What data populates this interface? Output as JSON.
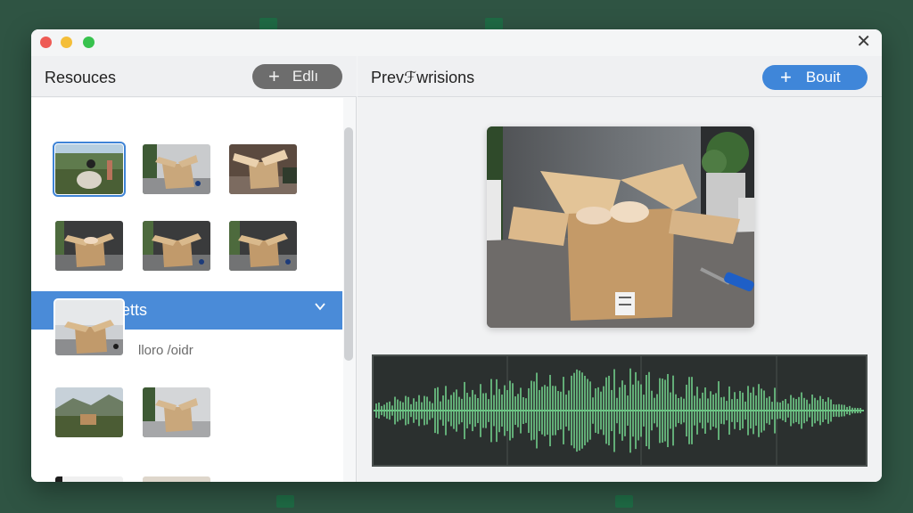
{
  "window": {
    "left_panel": {
      "title": "Resouces",
      "edit_button": {
        "icon": "plus-icon",
        "label": "Edlı"
      },
      "dropdown": {
        "label": "Seletts",
        "icon": "chevron-down-icon"
      },
      "hint": "lloro /oidr"
    },
    "right_panel": {
      "title": "Prevℱwrisions",
      "bout_button": {
        "icon": "plus-icon",
        "label": "Bouit"
      }
    }
  },
  "colors": {
    "accent": "#4a8bd8",
    "background": "#2f5443",
    "waveform": "#6cc384"
  }
}
